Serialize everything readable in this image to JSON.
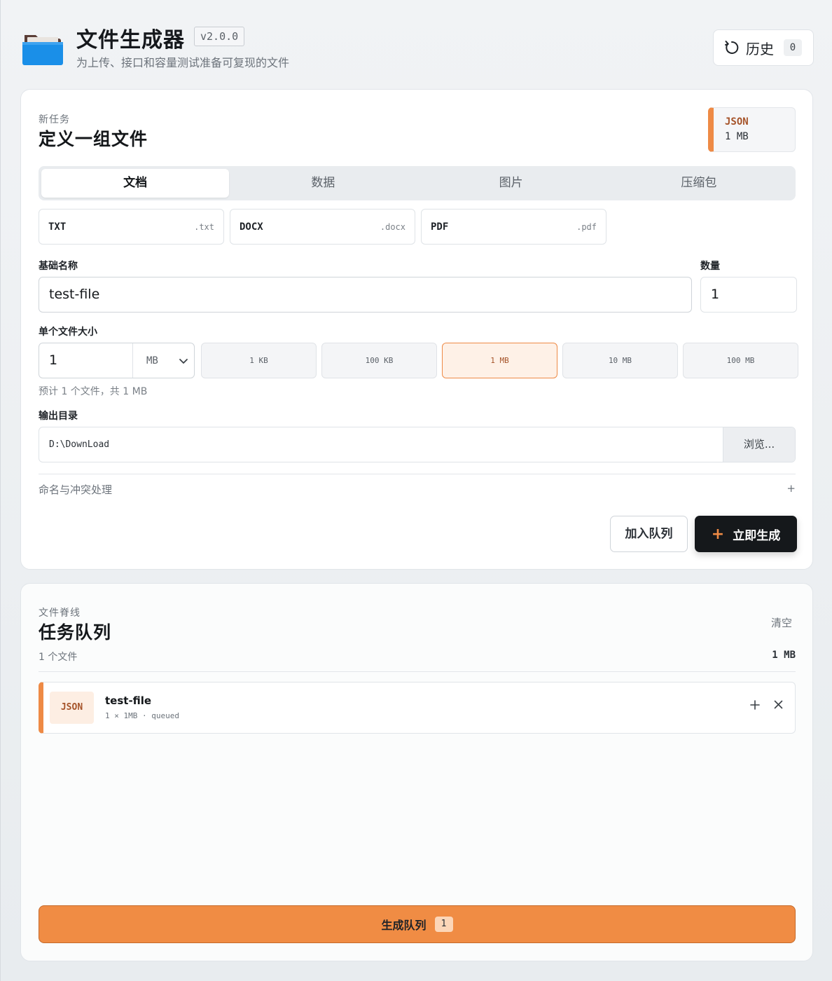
{
  "app": {
    "title": "文件生成器",
    "version": "v2.0.0",
    "subtitle": "为上传、接口和容量测试准备可复现的文件",
    "history_label": "历史",
    "history_count": "0"
  },
  "task": {
    "kicker": "新任务",
    "title": "定义一组文件",
    "summary_format": "JSON",
    "summary_size": "1 MB",
    "tabs": [
      {
        "label": "文档",
        "active": true
      },
      {
        "label": "数据",
        "active": false
      },
      {
        "label": "图片",
        "active": false
      },
      {
        "label": "压缩包",
        "active": false
      }
    ],
    "formats": [
      {
        "name": "TXT",
        "ext": ".txt"
      },
      {
        "name": "DOCX",
        "ext": ".docx"
      },
      {
        "name": "PDF",
        "ext": ".pdf"
      }
    ],
    "base_name_label": "基础名称",
    "base_name_value": "test-file",
    "quantity_label": "数量",
    "quantity_value": "1",
    "size_label": "单个文件大小",
    "size_value": "1",
    "size_unit": "MB",
    "presets": [
      {
        "label": "1 KB",
        "active": false
      },
      {
        "label": "100 KB",
        "active": false
      },
      {
        "label": "1 MB",
        "active": true
      },
      {
        "label": "10 MB",
        "active": false
      },
      {
        "label": "100 MB",
        "active": false
      }
    ],
    "estimate": "预计 1 个文件，共 1 MB",
    "output_dir_label": "输出目录",
    "output_dir_value": "D:\\DownLoad",
    "browse_label": "浏览...",
    "naming_label": "命名与冲突处理",
    "naming_toggle": "+",
    "add_queue_label": "加入队列",
    "generate_now_label": "立即生成",
    "generate_now_icon": "+"
  },
  "queue": {
    "kicker": "文件脊线",
    "title": "任务队列",
    "clear_label": "清空",
    "count_text": "1 个文件",
    "total_size": "1 MB",
    "items": [
      {
        "badge": "JSON",
        "name": "test-file",
        "detail": "1 × 1MB · queued"
      }
    ],
    "generate_label": "生成队列",
    "generate_count": "1"
  },
  "colors": {
    "accent": "#ee8a45",
    "primary_dark": "#15181b",
    "folder_blue": "#1a8fe8",
    "folder_back": "#5a3d36"
  },
  "icons": {
    "app": "folder-icon",
    "history": "refresh-icon",
    "dropdown": "chevron-down-icon",
    "add": "plus-icon",
    "remove": "close-icon"
  }
}
